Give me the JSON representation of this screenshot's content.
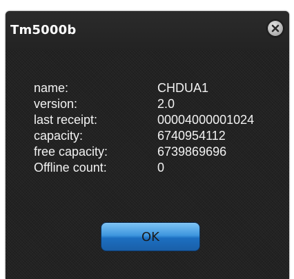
{
  "dialog": {
    "title": "Tm5000b",
    "close_icon": "close-icon",
    "fields": [
      {
        "label": "name:",
        "value": "CHDUA1"
      },
      {
        "label": "version:",
        "value": "2.0"
      },
      {
        "label": "last receipt:",
        "value": "00004000001024"
      },
      {
        "label": "capacity:",
        "value": "6740954112"
      },
      {
        "label": "free capacity:",
        "value": "6739869696"
      },
      {
        "label": "Offline count:",
        "value": "0"
      }
    ],
    "ok_label": "OK"
  },
  "colors": {
    "background": "#1f1f1f",
    "text": "#f2f2f2",
    "button_accent": "#3e96de"
  }
}
